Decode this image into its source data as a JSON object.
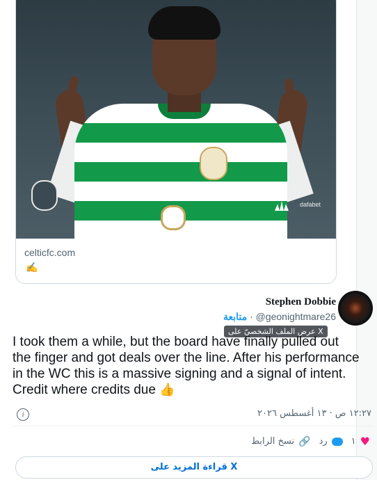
{
  "previous_card": {
    "domain": "celticfc.com",
    "emoji": "✍️",
    "image_brand_text": "dafabet"
  },
  "tweet": {
    "display_name": "Stephen Dobbie",
    "handle": "@geonightmare26",
    "separator": "·",
    "follow_label": "متابعة",
    "tooltip": "عرض الملف الشخصيّ على X",
    "text": "I took them a while, but the board have finally pulled out the finger and got deals over the line. After his performance in the WC this is a massive signing and a signal of intent. Credit where credits due",
    "text_emoji": "👍",
    "timestamp": "١٢:٢٧ ص · ١٣ أغسطس ٢٠٢٦",
    "info_icon": "ⓘ"
  },
  "actions": {
    "like_count": "١",
    "reply_label": "رد",
    "copy_link_label": "نسخ الرابط",
    "heart_icon": "♥",
    "link_icon": "🔗"
  },
  "more_button_label": "قراءة المزيد على X",
  "colors": {
    "accent": "#1d9bf0",
    "like": "#f91880",
    "link_blue": "#006fd6"
  }
}
